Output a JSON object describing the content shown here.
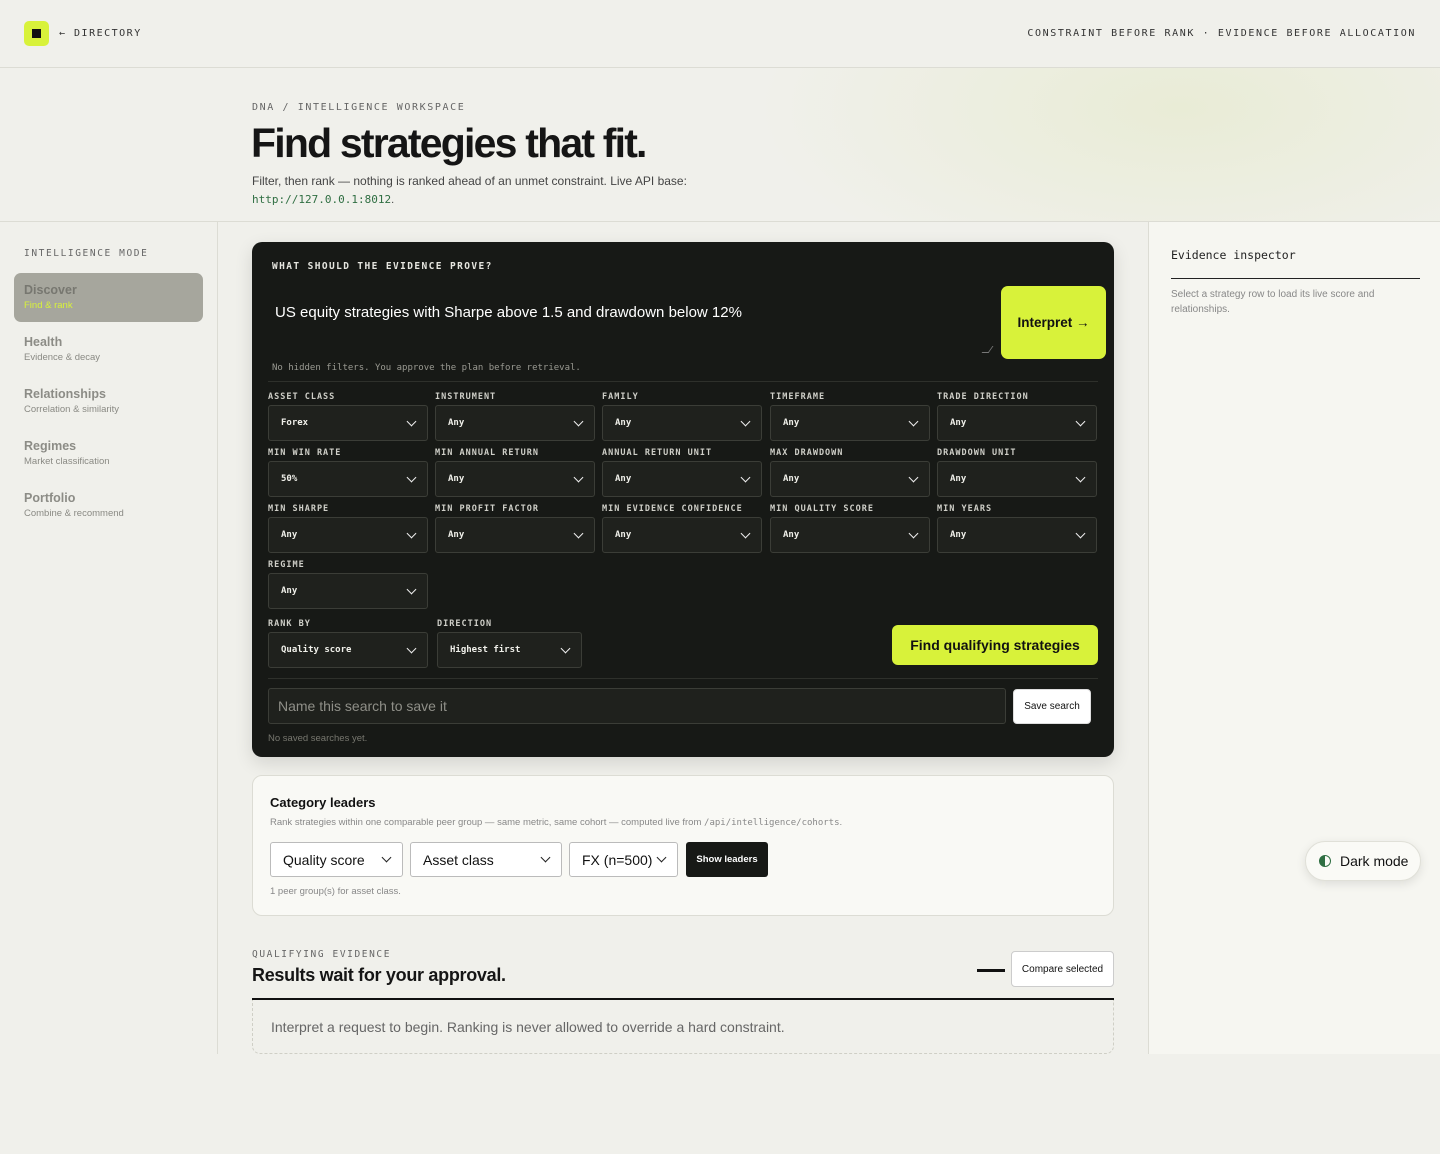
{
  "topbar": {
    "directory_link": "← DIRECTORY",
    "tagline": "CONSTRAINT BEFORE RANK · EVIDENCE BEFORE ALLOCATION"
  },
  "hero": {
    "breadcrumb": "DNA / INTELLIGENCE WORKSPACE",
    "title": "Find strategies that fit.",
    "subtitle": "Filter, then rank — nothing is ranked ahead of an unmet constraint. Live API base:",
    "api_base": "http://127.0.0.1:8012",
    "api_suffix": "."
  },
  "sidebar": {
    "heading": "INTELLIGENCE MODE",
    "items": [
      {
        "label": "Discover",
        "desc": "Find & rank",
        "active": true
      },
      {
        "label": "Health",
        "desc": "Evidence & decay"
      },
      {
        "label": "Relationships",
        "desc": "Correlation & similarity"
      },
      {
        "label": "Regimes",
        "desc": "Market classification"
      },
      {
        "label": "Portfolio",
        "desc": "Combine & recommend"
      }
    ]
  },
  "query_panel": {
    "heading": "WHAT SHOULD THE EVIDENCE PROVE?",
    "query_text": "US equity strategies with Sharpe above 1.5 and drawdown below 12%",
    "interpret_label": "Interpret →",
    "note": "No hidden filters. You approve the plan before retrieval.",
    "filters": [
      {
        "label": "ASSET CLASS",
        "value": "Forex"
      },
      {
        "label": "INSTRUMENT",
        "value": "Any"
      },
      {
        "label": "FAMILY",
        "value": "Any"
      },
      {
        "label": "TIMEFRAME",
        "value": "Any"
      },
      {
        "label": "TRADE DIRECTION",
        "value": "Any"
      },
      {
        "label": "MIN WIN RATE",
        "value": "50%"
      },
      {
        "label": "MIN ANNUAL RETURN",
        "value": "Any"
      },
      {
        "label": "ANNUAL RETURN UNIT",
        "value": "Any"
      },
      {
        "label": "MAX DRAWDOWN",
        "value": "Any"
      },
      {
        "label": "DRAWDOWN UNIT",
        "value": "Any"
      },
      {
        "label": "MIN SHARPE",
        "value": "Any"
      },
      {
        "label": "MIN PROFIT FACTOR",
        "value": "Any"
      },
      {
        "label": "MIN EVIDENCE CONFIDENCE",
        "value": "Any"
      },
      {
        "label": "MIN QUALITY SCORE",
        "value": "Any"
      },
      {
        "label": "MIN YEARS",
        "value": "Any"
      },
      {
        "label": "REGIME",
        "value": "Any"
      }
    ],
    "rank_by": {
      "label": "RANK BY",
      "value": "Quality score"
    },
    "direction": {
      "label": "DIRECTION",
      "value": "Highest first"
    },
    "find_label": "Find qualifying strategies",
    "save_placeholder": "Name this search to save it",
    "save_label": "Save search",
    "saved_note": "No saved searches yet."
  },
  "leaders": {
    "title": "Category leaders",
    "desc_prefix": "Rank strategies within one comparable peer group — same metric, same cohort — computed live from",
    "desc_endpoint": "/api/intelligence/cohorts",
    "desc_suffix": ".",
    "metric": "Quality score",
    "grouping": "Asset class",
    "cohort": "FX (n=500)",
    "show_label": "Show leaders",
    "count_note": "1 peer group(s) for asset class."
  },
  "results": {
    "kicker": "QUALIFYING EVIDENCE",
    "title": "Results wait for your approval.",
    "compare_label": "Compare selected",
    "empty_text": "Interpret a request to begin. Ranking is never allowed to override a hard constraint."
  },
  "inspector": {
    "title": "Evidence inspector",
    "text": "Select a strategy row to load its live score and relationships."
  },
  "theme_toggle": {
    "label": "Dark mode"
  },
  "colors": {
    "accent": "#d8f23a",
    "panel": "#171916",
    "link_green": "#2f6e42"
  }
}
